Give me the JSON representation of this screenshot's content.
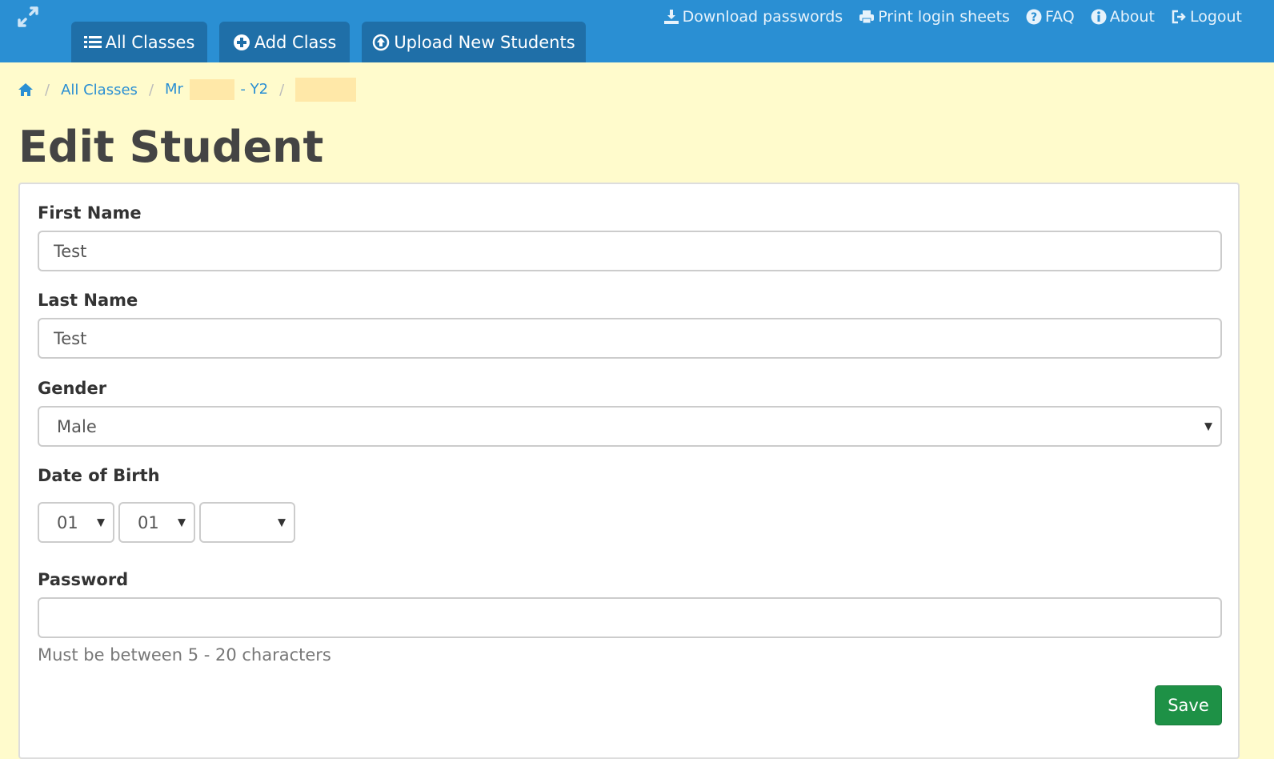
{
  "nav": {
    "tabs": [
      {
        "label": "All Classes",
        "icon": "list-icon"
      },
      {
        "label": "Add Class",
        "icon": "plus-circle-icon"
      },
      {
        "label": "Upload New Students",
        "icon": "upload-circle-icon"
      }
    ],
    "links": [
      {
        "label": "Download passwords",
        "icon": "download-icon"
      },
      {
        "label": "Print login sheets",
        "icon": "print-icon"
      },
      {
        "label": "FAQ",
        "icon": "question-circle-icon"
      },
      {
        "label": "About",
        "icon": "info-circle-icon"
      },
      {
        "label": "Logout",
        "icon": "logout-icon"
      }
    ]
  },
  "breadcrumb": {
    "home_icon": "home-icon",
    "items": [
      "All Classes",
      "Mr",
      "- Y2"
    ]
  },
  "page": {
    "title": "Edit Student"
  },
  "form": {
    "first_name_label": "First Name",
    "first_name_value": "Test",
    "last_name_label": "Last Name",
    "last_name_value": "Test",
    "gender_label": "Gender",
    "gender_value": "Male",
    "dob_label": "Date of Birth",
    "dob_day": "01",
    "dob_month": "01",
    "dob_year": "",
    "password_label": "Password",
    "password_value": "",
    "password_help": "Must be between 5 - 20 characters",
    "save_label": "Save"
  },
  "colors": {
    "topbar": "#2a8fd3",
    "tab": "#1f6fa8",
    "page_bg": "#fffbcc",
    "save_button": "#1e9146"
  }
}
